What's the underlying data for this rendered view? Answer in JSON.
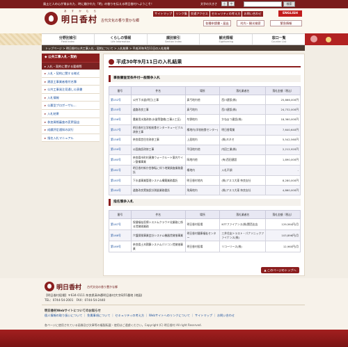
{
  "topbar": {
    "lead": "風土と人の心が育まれた、時に趣かれた「明」の香りを伝える明日香村へようこそ！",
    "fontsize_label": "文字の大きさ",
    "fs_small": "小",
    "fs_mid": "中",
    "fs_large": "大",
    "search_button": "検索"
  },
  "header": {
    "logo_ruby": "あ す か む ら",
    "logo_name": "明日香村",
    "logo_sub": "古代文化の香り豊かな郷",
    "util": [
      "サイトマップ",
      "リンク集",
      "交通アクセス",
      "セキュリティの考え方",
      "お問い合わせ"
    ],
    "english": "ENGLISH",
    "btn_forms": "各種申請書・届出",
    "btn_search": "村内・観光検索",
    "btn_disaster": "緊急情報"
  },
  "nav": [
    {
      "t": "分野別索引",
      "e": "Field Index"
    },
    {
      "t": "くらしの情報",
      "e": "Life Information"
    },
    {
      "t": "課別索引",
      "e": "Section Index"
    },
    {
      "t": "観光情報",
      "e": "Sightseeing"
    },
    {
      "t": "窓口一覧",
      "e": "Counter List"
    }
  ],
  "breadcrumb": {
    "items": [
      "トップページ",
      "明日香村公共工事入札・契約について",
      "入札結果"
    ],
    "current": "平成30年9月11日の入札結果"
  },
  "sidebar": {
    "head": "公共工事入札・契約",
    "sub": "入札・契約に関する要綱等",
    "items": [
      "入札・契約に関する様式",
      "建設工事業者格付名簿",
      "公共工事発注見通し公表書",
      "入札情報",
      "公募型プロポーザル...",
      "入札結果",
      "参加資格審査の変更届出",
      "成績評定通知の試行",
      "指名入札マニュアル"
    ]
  },
  "main": {
    "title": "平成30年9月11日の入札結果",
    "sec1": "事後審査型条件付一般競争入札",
    "sec2": "指名競争入札",
    "headers": [
      "番号",
      "件名",
      "場所",
      "落札業者名",
      "落札金額（税込）"
    ],
    "table1": [
      [
        "第152号",
        "公共下水道(明日)工事",
        "真弓地内他",
        "西川建設(株)",
        "25,866,000円"
      ],
      [
        "第155号",
        "道路改良工事",
        "真弓地内",
        "西川建設(株)",
        "24,732,000円"
      ],
      [
        "第156号",
        "農業用水路改修(水量等整備)工事(1工区)",
        "冬野地内",
        "かねまつ建設(株)",
        "18,360,000円"
      ],
      [
        "第157号",
        "明日香村立学校給食センターキュービクル改修工事",
        "橘地内(学校給食センター)",
        "明日香電業",
        "7,640,640円"
      ],
      [
        "第158号",
        "奈良県営住宅改修工事",
        "上居地内",
        "(株)ネネセ",
        "5,542,560円"
      ],
      [
        "第159号",
        "公園施設改修工事",
        "平田地内他",
        "内田工業(株)",
        "2,212,920円"
      ],
      [
        "第160号",
        "奈良県市町村連携ウォークルート案内サイン整備事業",
        "岡地内他",
        "(有)西田建設",
        "1,890,000円"
      ],
      [
        "第161号",
        "明日香村新庁舎移転に伴う地質調査業務委託",
        "橘地内",
        "入札不調",
        "-"
      ],
      [
        "第163号",
        "下水道事業管理システム構築業務委託",
        "明日香村地内",
        "(株)アスコ大東 奈良支社",
        "8,280,000円"
      ],
      [
        "第164号",
        "道路改良実施設計測量業務委託",
        "飛鳥地内",
        "(株)アスコ大東 奈良支社",
        "4,860,000円"
      ]
    ],
    "table2": [
      [
        "第167号",
        "保健福祉医療システムクラウド化業務に係る賃貸借業務",
        "明日香村役場",
        "NTTファイナンス(株)関西支店",
        "129,564円/月"
      ],
      [
        "第168号",
        "介護保険事業会計システム機器賃貸借事業",
        "明日香村健康福祉センター",
        "三井住友トラスト・パナソニックファイナンス(株)",
        "103,896円/月"
      ],
      [
        "第169号",
        "奈良県土木積算システムパソコン賃貸借事業",
        "明日香村役場",
        "リコーリース(株)",
        "12,960円/月"
      ]
    ],
    "pagetop": "このページのトップへ"
  },
  "footer": {
    "name": "明日香村",
    "sub": "古代文化の香り豊かな郷",
    "addr": "【明日香村役場】〒634-0111 奈良県高市郡明日香村大字岡55番地 (地図)",
    "tel": "TEL：0744-54-2001　FAX：0744-54-2440",
    "site_h": "明日香村Webサイトについてのお知らせ",
    "links": "個人情報の取り扱いについて ｜ 免責事項について ｜ セキュリティの考え方 ｜ Webサイトへのリンクについて ｜ サイトマップ ｜ お問い合わせ",
    "copy": "各ページに使用されている画像及び文章等の複製転載・使用はご遠慮ください。Copyright (C) 明日香村 All right Reserved."
  }
}
